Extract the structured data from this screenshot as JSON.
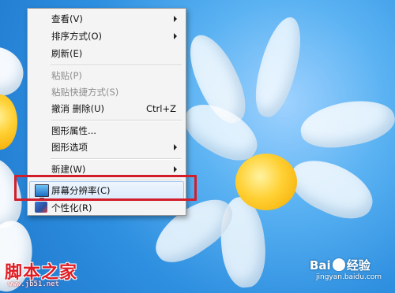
{
  "context_menu": {
    "items": [
      {
        "label": "查看(V)",
        "submenu": true
      },
      {
        "label": "排序方式(O)",
        "submenu": true
      },
      {
        "label": "刷新(E)"
      },
      {
        "label": "粘贴(P)",
        "disabled": true
      },
      {
        "label": "粘贴快捷方式(S)",
        "disabled": true
      },
      {
        "label": "撤消 删除(U)",
        "shortcut": "Ctrl+Z"
      },
      {
        "label": "图形属性..."
      },
      {
        "label": "图形选项",
        "submenu": true
      },
      {
        "label": "新建(W)",
        "submenu": true
      },
      {
        "label": "屏幕分辨率(C)",
        "highlighted": true,
        "icon": "screen-resolution-icon"
      },
      {
        "label": "个性化(R)",
        "icon": "personalize-icon"
      }
    ]
  },
  "annotation": {
    "color": "#d21e2a"
  },
  "watermarks": {
    "left_title": "脚本之家",
    "left_url": "www.jb51.net",
    "right_brand_a": "Bai",
    "right_brand_b": "经验",
    "right_url": "jingyan.baidu.com"
  }
}
